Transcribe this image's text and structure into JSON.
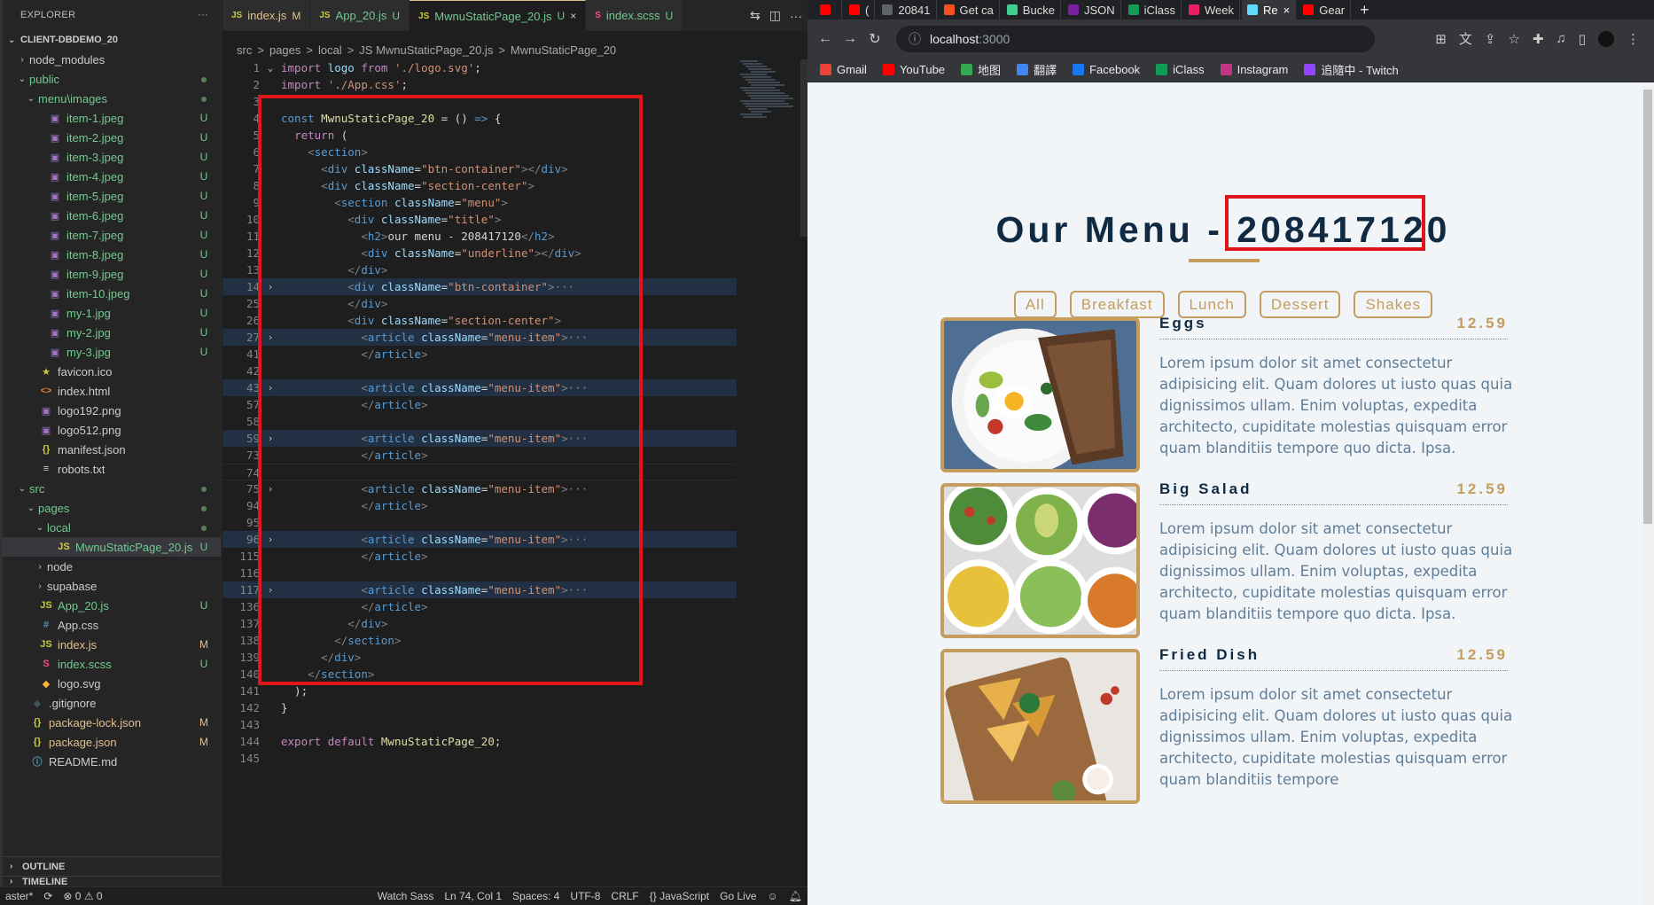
{
  "vscode": {
    "explorer": {
      "title": "EXPLORER",
      "more": "···",
      "root": "CLIENT-DBDEMO_20",
      "tree": [
        {
          "label": "node_modules",
          "kind": "folder",
          "indent": 1,
          "open": false,
          "color": "gray",
          "status": ""
        },
        {
          "label": "public",
          "kind": "folder",
          "indent": 1,
          "open": true,
          "color": "green",
          "status": "dot"
        },
        {
          "label": "menu\\images",
          "kind": "folder",
          "indent": 2,
          "open": true,
          "color": "green",
          "status": "dot"
        },
        {
          "label": "item-1.jpeg",
          "kind": "img",
          "indent": 3,
          "color": "green",
          "status": "U"
        },
        {
          "label": "item-2.jpeg",
          "kind": "img",
          "indent": 3,
          "color": "green",
          "status": "U"
        },
        {
          "label": "item-3.jpeg",
          "kind": "img",
          "indent": 3,
          "color": "green",
          "status": "U"
        },
        {
          "label": "item-4.jpeg",
          "kind": "img",
          "indent": 3,
          "color": "green",
          "status": "U"
        },
        {
          "label": "item-5.jpeg",
          "kind": "img",
          "indent": 3,
          "color": "green",
          "status": "U"
        },
        {
          "label": "item-6.jpeg",
          "kind": "img",
          "indent": 3,
          "color": "green",
          "status": "U"
        },
        {
          "label": "item-7.jpeg",
          "kind": "img",
          "indent": 3,
          "color": "green",
          "status": "U"
        },
        {
          "label": "item-8.jpeg",
          "kind": "img",
          "indent": 3,
          "color": "green",
          "status": "U"
        },
        {
          "label": "item-9.jpeg",
          "kind": "img",
          "indent": 3,
          "color": "green",
          "status": "U"
        },
        {
          "label": "item-10.jpeg",
          "kind": "img",
          "indent": 3,
          "color": "green",
          "status": "U"
        },
        {
          "label": "my-1.jpg",
          "kind": "img",
          "indent": 3,
          "color": "green",
          "status": "U"
        },
        {
          "label": "my-2.jpg",
          "kind": "img",
          "indent": 3,
          "color": "green",
          "status": "U"
        },
        {
          "label": "my-3.jpg",
          "kind": "img",
          "indent": 3,
          "color": "green",
          "status": "U"
        },
        {
          "label": "favicon.ico",
          "kind": "star",
          "indent": 2,
          "color": "gray",
          "status": ""
        },
        {
          "label": "index.html",
          "kind": "html",
          "indent": 2,
          "color": "gray",
          "status": ""
        },
        {
          "label": "logo192.png",
          "kind": "img",
          "indent": 2,
          "color": "gray",
          "status": ""
        },
        {
          "label": "logo512.png",
          "kind": "img",
          "indent": 2,
          "color": "gray",
          "status": ""
        },
        {
          "label": "manifest.json",
          "kind": "json",
          "indent": 2,
          "color": "gray",
          "status": ""
        },
        {
          "label": "robots.txt",
          "kind": "txt",
          "indent": 2,
          "color": "gray",
          "status": ""
        },
        {
          "label": "src",
          "kind": "folder",
          "indent": 1,
          "open": true,
          "color": "green",
          "status": "dot"
        },
        {
          "label": "pages",
          "kind": "folder",
          "indent": 2,
          "open": true,
          "color": "green",
          "status": "dot"
        },
        {
          "label": "local",
          "kind": "folder",
          "indent": 3,
          "open": true,
          "color": "green",
          "status": "dot"
        },
        {
          "label": "MwnuStaticPage_20.js",
          "kind": "js",
          "indent": 4,
          "color": "green",
          "status": "U",
          "selected": true
        },
        {
          "label": "node",
          "kind": "folder",
          "indent": 3,
          "open": false,
          "color": "gray",
          "status": ""
        },
        {
          "label": "supabase",
          "kind": "folder",
          "indent": 3,
          "open": false,
          "color": "gray",
          "status": ""
        },
        {
          "label": "App_20.js",
          "kind": "js",
          "indent": 2,
          "color": "green",
          "status": "U"
        },
        {
          "label": "App.css",
          "kind": "css",
          "indent": 2,
          "color": "gray",
          "status": ""
        },
        {
          "label": "index.js",
          "kind": "js",
          "indent": 2,
          "color": "yellow",
          "status": "M"
        },
        {
          "label": "index.scss",
          "kind": "scss",
          "indent": 2,
          "color": "green",
          "status": "U"
        },
        {
          "label": "logo.svg",
          "kind": "svg",
          "indent": 2,
          "color": "gray",
          "status": ""
        },
        {
          "label": ".gitignore",
          "kind": "git",
          "indent": 1,
          "color": "gray",
          "status": ""
        },
        {
          "label": "package-lock.json",
          "kind": "json",
          "indent": 1,
          "color": "yellow",
          "status": "M"
        },
        {
          "label": "package.json",
          "kind": "json",
          "indent": 1,
          "color": "yellow",
          "status": "M"
        },
        {
          "label": "README.md",
          "kind": "info",
          "indent": 1,
          "color": "gray",
          "status": ""
        }
      ],
      "outline": "OUTLINE",
      "timeline": "TIMELINE"
    },
    "tabs": [
      {
        "icon": "JS",
        "label": "index.js",
        "mark": "M",
        "active": false
      },
      {
        "icon": "JS",
        "label": "App_20.js",
        "mark": "U",
        "active": false
      },
      {
        "icon": "JS",
        "label": "MwnuStaticPage_20.js",
        "mark": "U",
        "active": true
      },
      {
        "icon": "S",
        "label": "index.scss",
        "mark": "U",
        "active": false
      }
    ],
    "breadcrumb": [
      "src",
      ">",
      "pages",
      ">",
      "local",
      ">",
      "JS MwnuStaticPage_20.js",
      ">",
      "MwnuStaticPage_20"
    ],
    "code": [
      {
        "n": "1",
        "fold": "v",
        "html": "<span class='tk-kw'>import</span> <span class='tk-att'>logo</span> <span class='tk-kw'>from</span> <span class='tk-str'>'./logo.svg'</span>;"
      },
      {
        "n": "2",
        "fold": "",
        "html": "<span class='tk-kw'>import</span> <span class='tk-str'>'./App.css'</span>;"
      },
      {
        "n": "3",
        "fold": "",
        "html": ""
      },
      {
        "n": "4",
        "fold": "",
        "html": "<span class='tk-bl'>const</span> <span class='tk-fn'>MwnuStaticPage_20</span> = () <span class='tk-bl'>=&gt;</span> {"
      },
      {
        "n": "5",
        "fold": "",
        "html": "  <span class='tk-kw'>return</span> ("
      },
      {
        "n": "6",
        "fold": "",
        "html": "    <span class='tk-gray'>&lt;</span><span class='tk-tag'>section</span><span class='tk-gray'>&gt;</span>"
      },
      {
        "n": "7",
        "fold": "",
        "html": "      <span class='tk-gray'>&lt;</span><span class='tk-tag'>div</span> <span class='tk-att'>className</span>=<span class='tk-str'>\"btn-container\"</span><span class='tk-gray'>&gt;&lt;/</span><span class='tk-tag'>div</span><span class='tk-gray'>&gt;</span>"
      },
      {
        "n": "8",
        "fold": "",
        "html": "      <span class='tk-gray'>&lt;</span><span class='tk-tag'>div</span> <span class='tk-att'>className</span>=<span class='tk-str'>\"section-center\"</span><span class='tk-gray'>&gt;</span>"
      },
      {
        "n": "9",
        "fold": "",
        "html": "        <span class='tk-gray'>&lt;</span><span class='tk-tag'>section</span> <span class='tk-att'>className</span>=<span class='tk-str'>\"menu\"</span><span class='tk-gray'>&gt;</span>"
      },
      {
        "n": "10",
        "fold": "",
        "html": "          <span class='tk-gray'>&lt;</span><span class='tk-tag'>div</span> <span class='tk-att'>className</span>=<span class='tk-str'>\"title\"</span><span class='tk-gray'>&gt;</span>"
      },
      {
        "n": "11",
        "fold": "",
        "html": "            <span class='tk-gray'>&lt;</span><span class='tk-tag'>h2</span><span class='tk-gray'>&gt;</span>our menu - 208417120<span class='tk-gray'>&lt;/</span><span class='tk-tag'>h2</span><span class='tk-gray'>&gt;</span>"
      },
      {
        "n": "12",
        "fold": "",
        "html": "            <span class='tk-gray'>&lt;</span><span class='tk-tag'>div</span> <span class='tk-att'>className</span>=<span class='tk-str'>\"underline\"</span><span class='tk-gray'>&gt;&lt;/</span><span class='tk-tag'>div</span><span class='tk-gray'>&gt;</span>"
      },
      {
        "n": "13",
        "fold": "",
        "html": "          <span class='tk-gray'>&lt;/</span><span class='tk-tag'>div</span><span class='tk-gray'>&gt;</span>"
      },
      {
        "n": "14",
        "fold": ">",
        "hl": true,
        "html": "          <span class='tk-gray'>&lt;</span><span class='tk-tag'>div</span> <span class='tk-att'>className</span>=<span class='tk-str'>\"btn-container\"</span><span class='tk-gray'>&gt;</span><span class='tk-gray'>···</span>"
      },
      {
        "n": "25",
        "fold": "",
        "html": "          <span class='tk-gray'>&lt;/</span><span class='tk-tag'>div</span><span class='tk-gray'>&gt;</span>"
      },
      {
        "n": "26",
        "fold": "",
        "html": "          <span class='tk-gray'>&lt;</span><span class='tk-tag'>div</span> <span class='tk-att'>className</span>=<span class='tk-str'>\"section-center\"</span><span class='tk-gray'>&gt;</span>"
      },
      {
        "n": "27",
        "fold": ">",
        "hl": true,
        "html": "            <span class='tk-gray'>&lt;</span><span class='tk-tag'>article</span> <span class='tk-att'>className</span>=<span class='tk-str'>\"menu-item\"</span><span class='tk-gray'>&gt;</span><span class='tk-gray'>···</span>"
      },
      {
        "n": "41",
        "fold": "",
        "html": "            <span class='tk-gray'>&lt;/</span><span class='tk-tag'>article</span><span class='tk-gray'>&gt;</span>"
      },
      {
        "n": "42",
        "fold": "",
        "html": ""
      },
      {
        "n": "43",
        "fold": ">",
        "hl": true,
        "html": "            <span class='tk-gray'>&lt;</span><span class='tk-tag'>article</span> <span class='tk-att'>className</span>=<span class='tk-str'>\"menu-item\"</span><span class='tk-gray'>&gt;</span><span class='tk-gray'>···</span>"
      },
      {
        "n": "57",
        "fold": "",
        "html": "            <span class='tk-gray'>&lt;/</span><span class='tk-tag'>article</span><span class='tk-gray'>&gt;</span>"
      },
      {
        "n": "58",
        "fold": "",
        "html": ""
      },
      {
        "n": "59",
        "fold": ">",
        "hl": true,
        "html": "            <span class='tk-gray'>&lt;</span><span class='tk-tag'>article</span> <span class='tk-att'>className</span>=<span class='tk-str'>\"menu-item\"</span><span class='tk-gray'>&gt;</span><span class='tk-gray'>···</span>"
      },
      {
        "n": "73",
        "fold": "",
        "html": "            <span class='tk-gray'>&lt;/</span><span class='tk-tag'>article</span><span class='tk-gray'>&gt;</span>"
      },
      {
        "n": "74",
        "fold": "",
        "cur": true,
        "html": ""
      },
      {
        "n": "75",
        "fold": ">",
        "html": "            <span class='tk-gray'>&lt;</span><span class='tk-tag'>article</span> <span class='tk-att'>className</span>=<span class='tk-str'>\"menu-item\"</span><span class='tk-gray'>&gt;</span><span class='tk-gray'>···</span>"
      },
      {
        "n": "94",
        "fold": "",
        "html": "            <span class='tk-gray'>&lt;/</span><span class='tk-tag'>article</span><span class='tk-gray'>&gt;</span>"
      },
      {
        "n": "95",
        "fold": "",
        "html": ""
      },
      {
        "n": "96",
        "fold": ">",
        "hl": true,
        "html": "            <span class='tk-gray'>&lt;</span><span class='tk-tag'>article</span> <span class='tk-att'>className</span>=<span class='tk-str'>\"menu-item\"</span><span class='tk-gray'>&gt;</span><span class='tk-gray'>···</span>"
      },
      {
        "n": "115",
        "fold": "",
        "html": "            <span class='tk-gray'>&lt;/</span><span class='tk-tag'>article</span><span class='tk-gray'>&gt;</span>"
      },
      {
        "n": "116",
        "fold": "",
        "html": ""
      },
      {
        "n": "117",
        "fold": ">",
        "hl": true,
        "html": "            <span class='tk-gray'>&lt;</span><span class='tk-tag'>article</span> <span class='tk-att'>className</span>=<span class='tk-str'>\"menu-item\"</span><span class='tk-gray'>&gt;</span><span class='tk-gray'>···</span>"
      },
      {
        "n": "136",
        "fold": "",
        "html": "            <span class='tk-gray'>&lt;/</span><span class='tk-tag'>article</span><span class='tk-gray'>&gt;</span>"
      },
      {
        "n": "137",
        "fold": "",
        "html": "          <span class='tk-gray'>&lt;/</span><span class='tk-tag'>div</span><span class='tk-gray'>&gt;</span>"
      },
      {
        "n": "138",
        "fold": "",
        "html": "        <span class='tk-gray'>&lt;/</span><span class='tk-tag'>section</span><span class='tk-gray'>&gt;</span>"
      },
      {
        "n": "139",
        "fold": "",
        "html": "      <span class='tk-gray'>&lt;/</span><span class='tk-tag'>div</span><span class='tk-gray'>&gt;</span>"
      },
      {
        "n": "140",
        "fold": "",
        "html": "    <span class='tk-gray'>&lt;/</span><span class='tk-tag'>section</span><span class='tk-gray'>&gt;</span>"
      },
      {
        "n": "141",
        "fold": "",
        "html": "  );"
      },
      {
        "n": "142",
        "fold": "",
        "html": "}"
      },
      {
        "n": "143",
        "fold": "",
        "html": ""
      },
      {
        "n": "144",
        "fold": "",
        "html": "<span class='tk-kw'>export</span> <span class='tk-kw'>default</span> <span class='tk-fn'>MwnuStaticPage_20</span>;"
      },
      {
        "n": "145",
        "fold": "",
        "html": ""
      }
    ],
    "status": {
      "branch": "aster*",
      "errors": "⊗ 0 ⚠ 0",
      "watch": "Watch Sass",
      "position": "Ln 74, Col 1",
      "spaces": "Spaces: 4",
      "encoding": "UTF-8",
      "eol": "CRLF",
      "language": "{} JavaScript",
      "golive": "Go Live"
    }
  },
  "browser": {
    "tabs": [
      {
        "label": "",
        "color": "#ff0000"
      },
      {
        "label": "(",
        "color": "#ff0000"
      },
      {
        "label": "20841",
        "color": "#5f6368"
      },
      {
        "label": "Get ca",
        "color": "#f4511e"
      },
      {
        "label": "Bucke",
        "color": "#3ecf8e"
      },
      {
        "label": "JSON",
        "color": "#7b1fa2"
      },
      {
        "label": "iClass",
        "color": "#0f9d58"
      },
      {
        "label": "Week",
        "color": "#e91e63"
      },
      {
        "label": "Re",
        "color": "#61dafb",
        "active": true
      },
      {
        "label": "Gear",
        "color": "#ff0000"
      }
    ],
    "url_host": "localhost",
    "url_port": ":3000",
    "bookmarks": [
      {
        "label": "Gmail",
        "color": "#ea4335"
      },
      {
        "label": "YouTube",
        "color": "#ff0000"
      },
      {
        "label": "地图",
        "color": "#34a853"
      },
      {
        "label": "翻譯",
        "color": "#4285f4"
      },
      {
        "label": "Facebook",
        "color": "#1877f2"
      },
      {
        "label": "iClass",
        "color": "#0f9d58"
      },
      {
        "label": "Instagram",
        "color": "#c13584"
      },
      {
        "label": "追隨中 - Twitch",
        "color": "#9146ff"
      }
    ],
    "page": {
      "title_prefix": "Our Menu - ",
      "title_id": "208417120",
      "filters": [
        "All",
        "Breakfast",
        "Lunch",
        "Dessert",
        "Shakes"
      ],
      "items": [
        {
          "name": "Eggs",
          "price": "12.59",
          "image": "eggs-photo",
          "desc": "Lorem ipsum dolor sit amet consectetur adipisicing elit. Quam dolores ut iusto quas quia dignissimos ullam. Enim voluptas, expedita architecto, cupiditate molestias quisquam error quam blanditiis tempore quo dicta. Ipsa."
        },
        {
          "name": "Big Salad",
          "price": "12.59",
          "image": "salad-photo",
          "desc": "Lorem ipsum dolor sit amet consectetur adipisicing elit. Quam dolores ut iusto quas quia dignissimos ullam. Enim voluptas, expedita architecto, cupiditate molestias quisquam error quam blanditiis tempore quo dicta. Ipsa."
        },
        {
          "name": "Fried Dish",
          "price": "12.59",
          "image": "fried-dish-photo",
          "desc": "Lorem ipsum dolor sit amet consectetur adipisicing elit. Quam dolores ut iusto quas quia dignissimos ullam. Enim voluptas, expedita architecto, cupiditate molestias quisquam error quam blanditiis tempore"
        }
      ]
    }
  },
  "colors": {
    "accent": "#c59d5f",
    "heading": "#102a42",
    "body_text": "#617d98",
    "highlight_box": "#e0161f"
  }
}
